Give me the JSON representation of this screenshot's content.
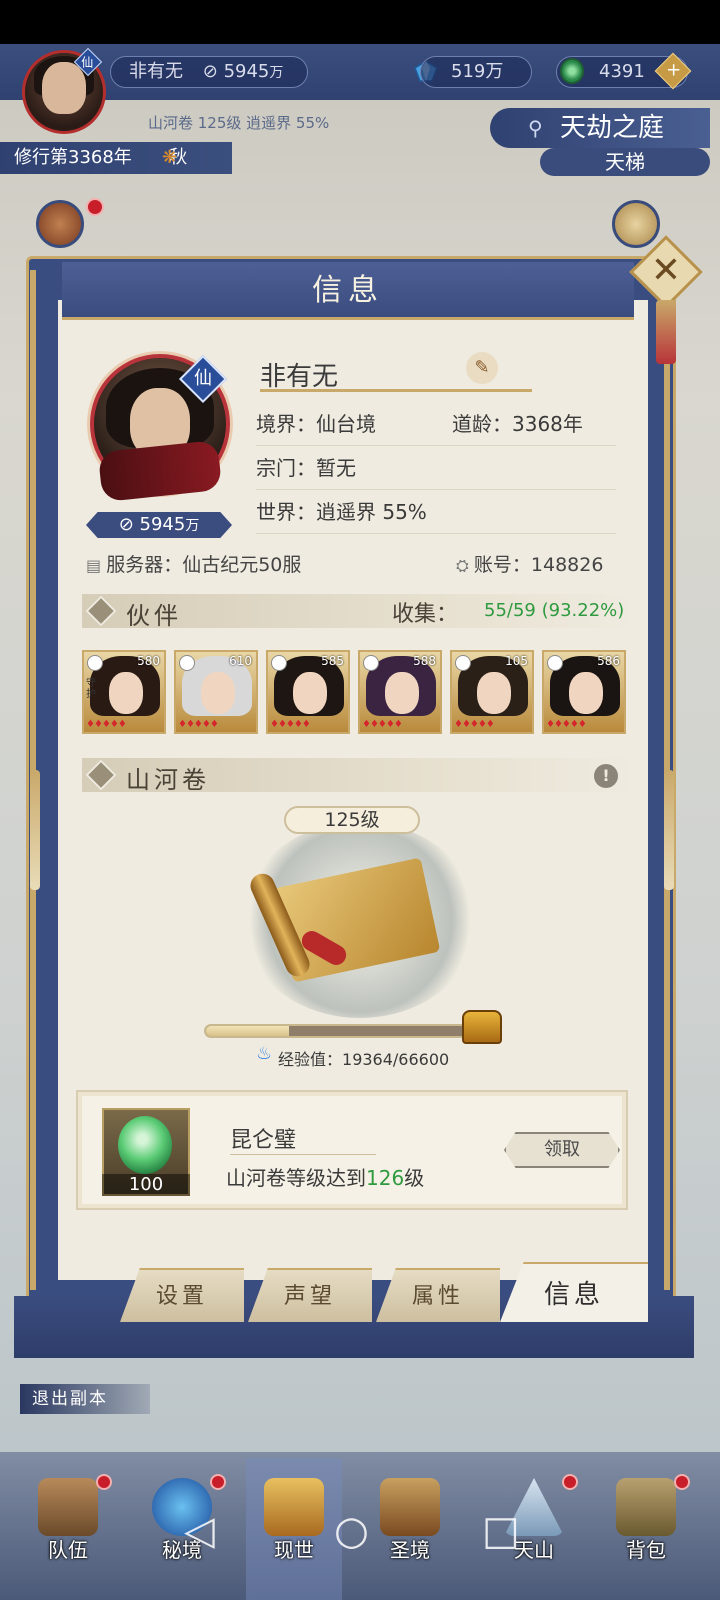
{
  "hud": {
    "player_name": "非有无",
    "power": "5945",
    "power_unit": "万",
    "jade": "519万",
    "coins": "4391",
    "xian_badge": "仙",
    "sub_info": "山河卷 125级 逍遥界 55%",
    "cultivation_year": "修行第3368年",
    "season": "秋",
    "location": "天劫之庭",
    "ladder": "天梯",
    "plus": "+"
  },
  "panel": {
    "title": "信息",
    "close_symbol": "✕",
    "profile": {
      "name": "非有无",
      "xian_badge": "仙",
      "power": "5945",
      "power_unit": "万",
      "realm_label": "境界：",
      "realm_value": "仙台境",
      "age_label": "道龄：",
      "age_value": "3368年",
      "sect_label": "宗门：",
      "sect_value": "暂无",
      "world_label": "世界：",
      "world_value": "逍遥界  55%",
      "server_label": "服务器：",
      "server_value": "仙古纪元50服",
      "account_label": "账号：",
      "account_value": "148826"
    },
    "partners": {
      "title": "伙伴",
      "collect_label": "收集：",
      "collect_value": "55/59 (93.22%)",
      "cards": [
        {
          "level": "580",
          "guard": "守护"
        },
        {
          "level": "610",
          "guard": ""
        },
        {
          "level": "585",
          "guard": ""
        },
        {
          "level": "588",
          "guard": ""
        },
        {
          "level": "105",
          "guard": ""
        },
        {
          "level": "586",
          "guard": ""
        }
      ]
    },
    "scroll": {
      "title": "山河卷",
      "info_symbol": "!",
      "level": "125级",
      "exp_label": "经验值：",
      "exp_value": "19364/66600",
      "exp_fraction": 0.29
    },
    "reward": {
      "name": "昆仑璧",
      "count": "100",
      "desc_prefix": "山河卷等级达到",
      "desc_level": "126",
      "desc_suffix": "级",
      "claim_label": "领取"
    },
    "tabs": [
      {
        "label": "设置"
      },
      {
        "label": "声望"
      },
      {
        "label": "属性"
      },
      {
        "label": "信息",
        "active": true
      }
    ]
  },
  "exit_label": "退出副本",
  "bottom_nav": [
    {
      "label": "队伍",
      "icon": "team-icon"
    },
    {
      "label": "秘境",
      "icon": "secret-realm-icon"
    },
    {
      "label": "现世",
      "icon": "present-world-icon"
    },
    {
      "label": "圣境",
      "icon": "holy-realm-icon"
    },
    {
      "label": "天山",
      "icon": "mountain-icon"
    },
    {
      "label": "背包",
      "icon": "bag-icon"
    }
  ],
  "colors": {
    "navy": "#3b4c7f",
    "gold": "#c9a96a",
    "parchment": "#efebe0",
    "green": "#2f9a3f",
    "red": "#c81e2a"
  }
}
